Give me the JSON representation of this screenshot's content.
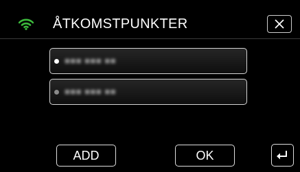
{
  "header": {
    "title": "ÅTKOMSTPUNKTER",
    "wifi_icon": "wifi-icon",
    "close_icon": "close-icon"
  },
  "access_points": [
    {
      "ssid": "■■■ ■■■ ■■",
      "selected": true
    },
    {
      "ssid": "■■■ ■■■ ■■",
      "selected": false
    }
  ],
  "footer": {
    "add_label": "ADD",
    "ok_label": "OK",
    "back_icon": "return-arrow-icon"
  },
  "colors": {
    "background": "#000000",
    "wifi_green": "#3cb93c",
    "border": "#d6d6d6",
    "text": "#ffffff"
  }
}
